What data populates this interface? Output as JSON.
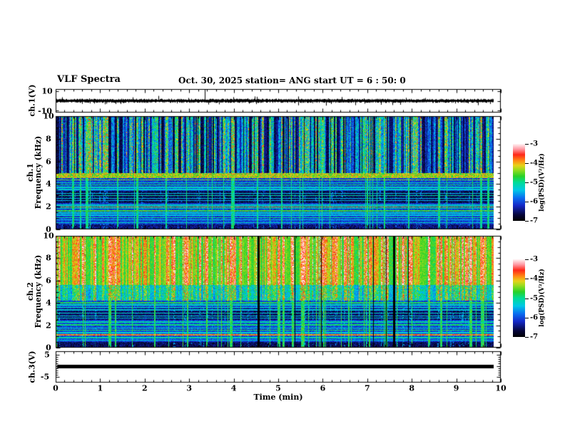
{
  "header": {
    "title": "VLF Spectra",
    "date": "Oct. 30, 2025",
    "station": "station= ANG",
    "start_ut": "start UT =  6 : 50: 0"
  },
  "x_axis": {
    "label": "Time (min)",
    "min": 0,
    "max": 10,
    "tick_labels": [
      "0",
      "1",
      "2",
      "3",
      "4",
      "5",
      "6",
      "7",
      "8",
      "9",
      "10"
    ],
    "minor_step": 0.2
  },
  "panels": [
    {
      "id": "ch1_wave",
      "ylabel": "ch.1(V)",
      "ytick_values": [
        10,
        -10
      ],
      "ytick_labels": [
        "10",
        "-10"
      ]
    },
    {
      "id": "ch1_spec",
      "ylabel_line1": "ch.1",
      "ylabel_line2": "Frequency (kHz)",
      "ytick_values": [
        10,
        8,
        6,
        4,
        2,
        0
      ],
      "ytick_labels": [
        "10",
        "8",
        "6",
        "4",
        "2",
        "0"
      ]
    },
    {
      "id": "ch2_spec",
      "ylabel_line1": "ch.2",
      "ylabel_line2": "Frequency (kHz)",
      "ytick_values": [
        10,
        8,
        6,
        4,
        2,
        0
      ],
      "ytick_labels": [
        "10",
        "8",
        "6",
        "4",
        "2",
        "0"
      ]
    },
    {
      "id": "ch3_wave",
      "ylabel": "ch.3(V)",
      "ytick_values": [
        5,
        -5
      ],
      "ytick_labels": [
        "5",
        "-5"
      ]
    }
  ],
  "colorbars": [
    {
      "label": "log(PSD)(V²/Hz)",
      "tick_labels": [
        "-3",
        "-4",
        "-5",
        "-6",
        "-7"
      ],
      "vmin": -7,
      "vmax": -3
    },
    {
      "label": "log(PSD)(V²/Hz)",
      "tick_labels": [
        "-3",
        "-4",
        "-5",
        "-6",
        "-7"
      ],
      "vmin": -7,
      "vmax": -3
    }
  ],
  "colormap_stops": [
    [
      0.0,
      "#000000"
    ],
    [
      0.08,
      "#06063a"
    ],
    [
      0.2,
      "#1428c8"
    ],
    [
      0.3,
      "#0a6ef0"
    ],
    [
      0.4,
      "#00c8e6"
    ],
    [
      0.5,
      "#00dc96"
    ],
    [
      0.58,
      "#28d228"
    ],
    [
      0.66,
      "#96dc1e"
    ],
    [
      0.72,
      "#e6d219"
    ],
    [
      0.78,
      "#ff8c14"
    ],
    [
      0.86,
      "#ff2819"
    ],
    [
      0.93,
      "#ff96a0"
    ],
    [
      1.0,
      "#fff5f5"
    ]
  ],
  "chart_data": [
    {
      "type": "line",
      "name": "ch1-waveform",
      "ylabel": "ch.1(V)",
      "xlim": [
        0,
        10
      ],
      "ylim": [
        -10,
        10
      ],
      "description": "broadband noise trace centered near 0 V, amplitude about ±1 V, sporadic spikes, one large spike to +10 V near t=3.4 min, record ends at t=9.85 min",
      "center_value": 0,
      "noise_amplitude_v": 1.0,
      "spike_t_min": 3.4,
      "spike_value_v": 10,
      "data_end_min": 9.85,
      "seed": 421
    },
    {
      "type": "heatmap",
      "name": "ch1-spectrogram",
      "xlim": [
        0,
        10
      ],
      "flim": [
        0,
        10
      ],
      "value_range": [
        -7,
        -3
      ],
      "description": "dense vertical sferic stripes (green/cyan, some red) above 5 kHz on dark blue background; bright band 4.6-5.0 kHz; below 4.5 kHz blue background with many narrow horizontal emission lines and dark bands 2.3-3.3 kHz",
      "seed": 1234,
      "fmax": 10,
      "stripe_pow": 1.3,
      "strong_frac": 0.09,
      "red_frac": 0.1,
      "upper_fmin": 4.95,
      "upper_bg": -6.9,
      "upper_jitter": 0.5,
      "stripe_gain": 2.6,
      "bright_band": [
        4.55,
        5.0
      ],
      "bright_level": -4.85,
      "lower_bg": -6.35,
      "lower_jitter": 0.55,
      "dark_bands": [
        [
          2.3,
          3.35,
          -0.55
        ],
        [
          0.0,
          0.4,
          -0.4
        ]
      ],
      "line_base": -6.0,
      "lines": [
        [
          4.35,
          1.5
        ],
        [
          4.1,
          0.9
        ],
        [
          3.9,
          1.1
        ],
        [
          3.7,
          0.8
        ],
        [
          3.5,
          0.7
        ],
        [
          3.15,
          0.6
        ],
        [
          2.95,
          0.9
        ],
        [
          2.7,
          0.6
        ],
        [
          2.5,
          0.5
        ],
        [
          2.1,
          0.8
        ],
        [
          1.95,
          1.6
        ],
        [
          1.8,
          0.9
        ],
        [
          1.6,
          1.3
        ],
        [
          1.4,
          0.7
        ],
        [
          1.2,
          0.6
        ],
        [
          1.0,
          1.0
        ],
        [
          0.8,
          0.6
        ],
        [
          0.55,
          0.8
        ]
      ],
      "cross_level": -5.4,
      "dark_col_frac": 0.0
    },
    {
      "type": "heatmap",
      "name": "ch2-spectrogram",
      "xlim": [
        0,
        10
      ],
      "flim": [
        0,
        10
      ],
      "value_range": [
        -7,
        -3
      ],
      "description": "intense red/orange/yellow vertical striping over green background above 5.6 kHz; green/cyan 4.2-5.6 kHz; below 4 kHz blue with horizontal cyan lines, dark bands 2.5-3.5 kHz, orange line near 1.1 kHz, occasional black dropout columns",
      "seed": 777,
      "fmax": 10,
      "stripe_pow": 1.2,
      "strong_frac": 0.12,
      "red_frac": 0.45,
      "upper_fmin": 5.6,
      "upper_bg": -5.0,
      "upper_jitter": 0.6,
      "stripe_gain": 1.8,
      "mid_fmin": 4.2,
      "mid_bg": -5.9,
      "mid_gain": 1.6,
      "lower_bg": -6.3,
      "lower_jitter": 0.55,
      "dark_bands": [
        [
          2.45,
          3.5,
          -0.5
        ],
        [
          0.0,
          0.45,
          -0.55
        ]
      ],
      "line_base": -6.0,
      "lines": [
        [
          4.0,
          1.2
        ],
        [
          3.8,
          0.8
        ],
        [
          3.6,
          0.9
        ],
        [
          3.35,
          0.6
        ],
        [
          3.05,
          0.8
        ],
        [
          2.8,
          0.7
        ],
        [
          2.6,
          0.6
        ],
        [
          2.25,
          0.9
        ],
        [
          2.0,
          1.1
        ],
        [
          1.7,
          0.8
        ],
        [
          1.5,
          1.2
        ],
        [
          1.3,
          0.7
        ],
        [
          1.1,
          2.1,
          0.08
        ],
        [
          0.85,
          0.9
        ],
        [
          0.6,
          0.7
        ]
      ],
      "cross_level": -5.2,
      "dark_col_frac": 0.012
    },
    {
      "type": "line",
      "name": "ch3-waveform",
      "ylabel": "ch.3(V)",
      "xlim": [
        0,
        10
      ],
      "ylim": [
        -5,
        5
      ],
      "description": "flat saturated trace at about +0.3 V across the full record",
      "constant_value": 0.3,
      "line_thickness_px": 5,
      "data_end_min": 9.85
    }
  ]
}
